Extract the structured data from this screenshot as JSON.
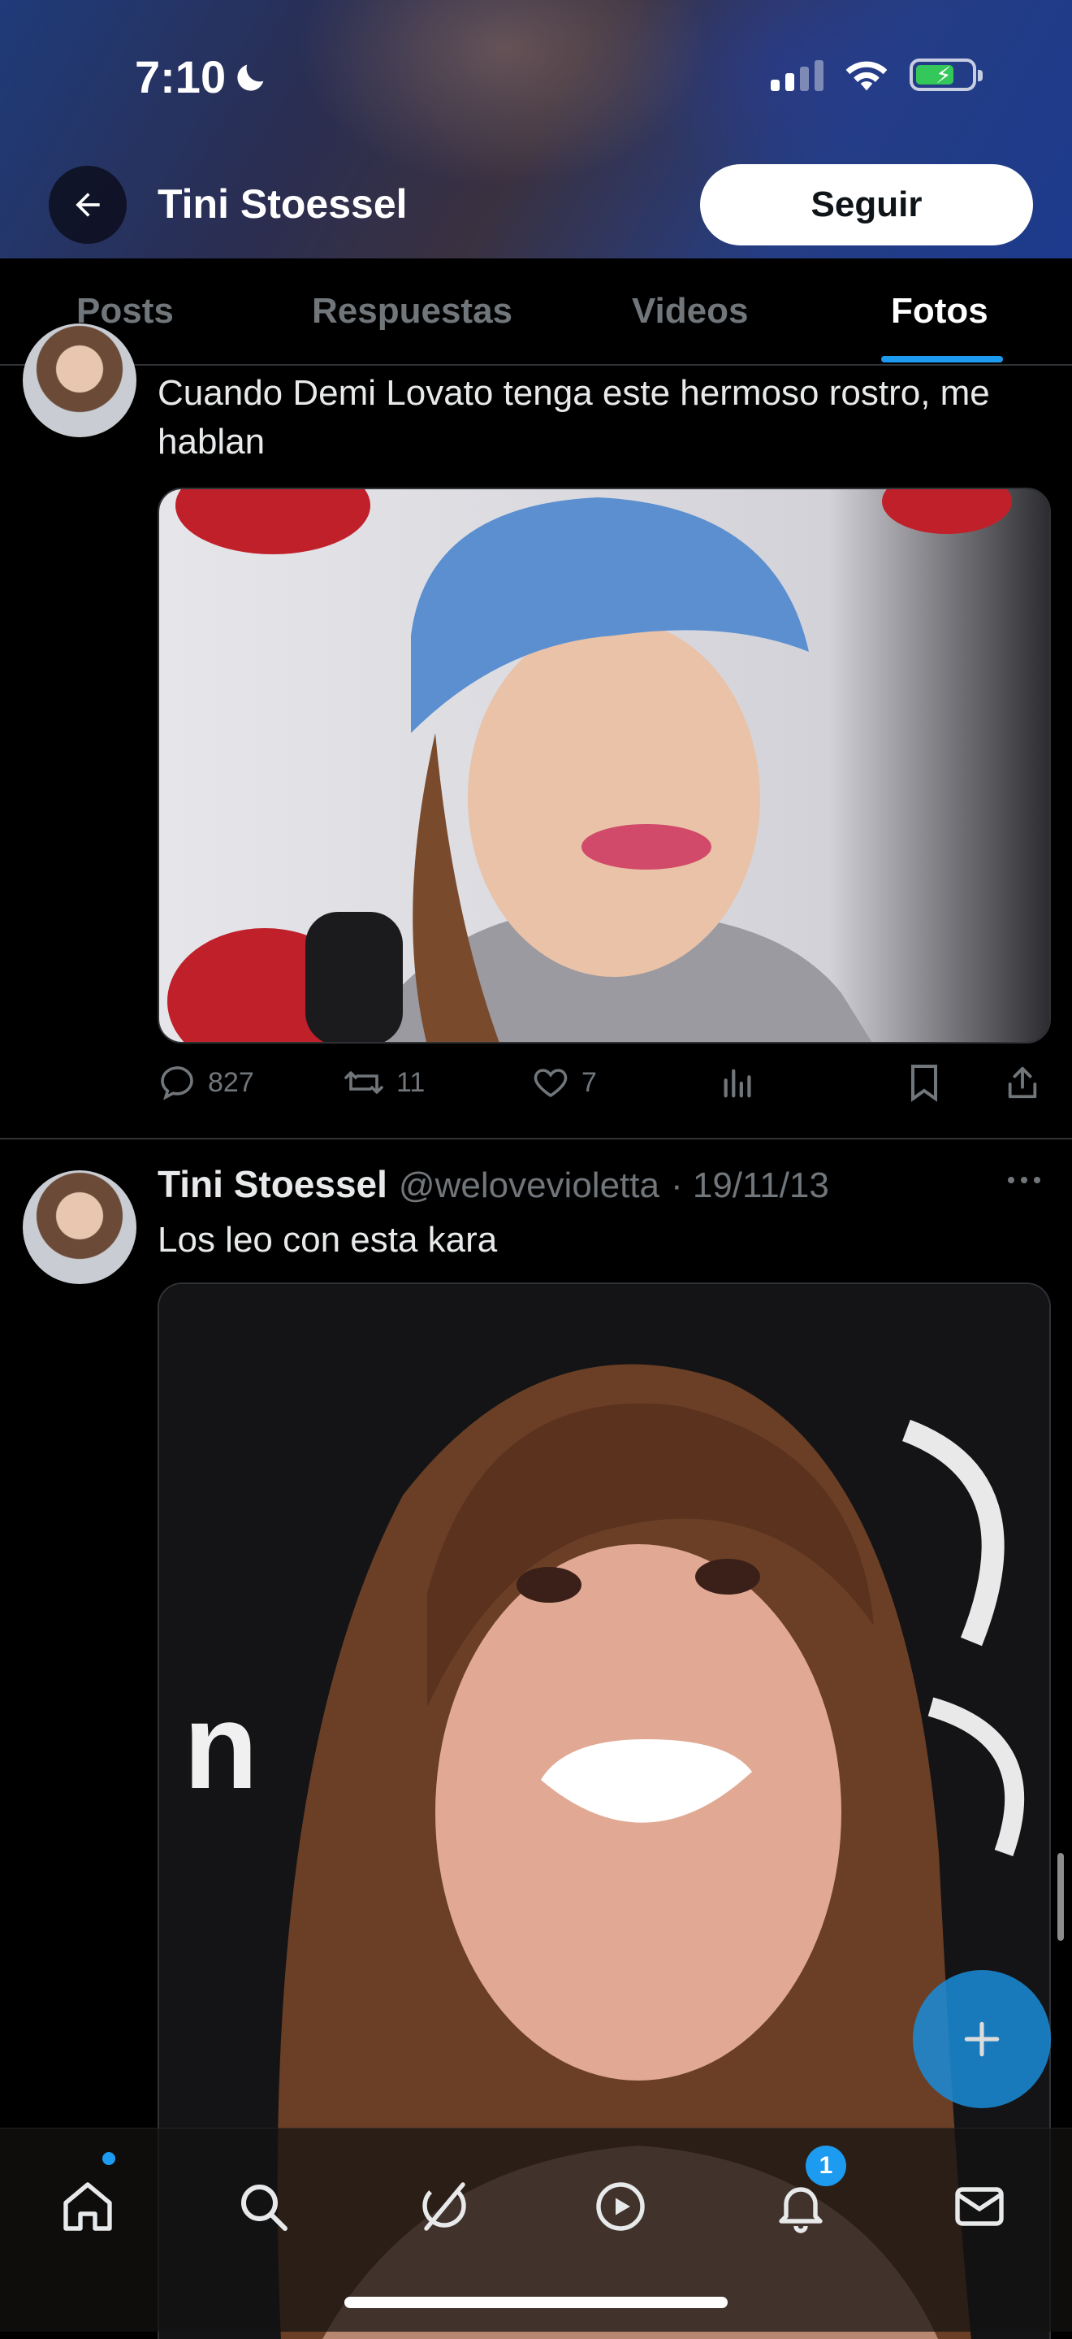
{
  "status_bar": {
    "time": "7:10"
  },
  "header": {
    "title": "Tini Stoessel",
    "follow_label": "Seguir"
  },
  "tabs": [
    {
      "label": "Posts",
      "active": false
    },
    {
      "label": "Respuestas",
      "active": false
    },
    {
      "label": "Videos",
      "active": false
    },
    {
      "label": "Fotos",
      "active": true
    }
  ],
  "posts": [
    {
      "text": "Cuando Demi Lovato tenga este hermoso rostro, me hablan",
      "image_icon": "photo",
      "stats": {
        "replies": "827",
        "reposts": "11",
        "likes": "7"
      }
    },
    {
      "name": "Tini Stoessel",
      "handle": "@weloveviolettа",
      "date": "· 19/11/13",
      "text": "Los leo con esta kara",
      "image_icon": "photo"
    }
  ],
  "nav": {
    "items": [
      "home-icon",
      "search-icon",
      "grok-icon",
      "video-icon",
      "notifications-icon",
      "messages-icon"
    ],
    "notifications_badge": "1"
  },
  "colors": {
    "accent": "#1d9bf0",
    "background": "#000000",
    "text_muted": "#71767b"
  }
}
